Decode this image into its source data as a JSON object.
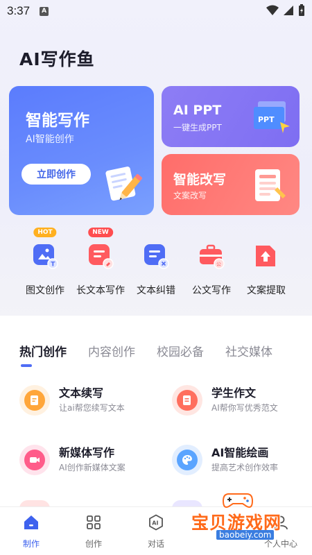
{
  "status_bar": {
    "time": "3:37",
    "badge": "A"
  },
  "app_title": "AI写作鱼",
  "cards": {
    "smart_write": {
      "title": "智能写作",
      "subtitle": "AI智能创作",
      "button": "立即创作"
    },
    "ppt": {
      "title": "AI PPT",
      "subtitle": "一键生成PPT",
      "art_label": "PPT"
    },
    "rewrite": {
      "title": "智能改写",
      "subtitle": "文案改写"
    }
  },
  "tools": [
    {
      "label": "图文创作",
      "tag": "HOT",
      "tag_color": "#ffb020"
    },
    {
      "label": "长文本写作",
      "tag": "NEW",
      "tag_color": "#ff4d4f"
    },
    {
      "label": "文本纠错",
      "tag": "",
      "tag_color": ""
    },
    {
      "label": "公文写作",
      "tag": "",
      "tag_color": ""
    },
    {
      "label": "文案提取",
      "tag": "",
      "tag_color": ""
    }
  ],
  "tabs": [
    "热门创作",
    "内容创作",
    "校园必备",
    "社交媒体"
  ],
  "active_tab": "热门创作",
  "features": [
    {
      "title": "文本续写",
      "desc": "让ai帮您续写文本",
      "color": "#ffa63a"
    },
    {
      "title": "学生作文",
      "desc": "AI帮你写优秀范文",
      "color": "#ff6f5e"
    },
    {
      "title": "新媒体写作",
      "desc": "AI创作新媒体文案",
      "color": "#ff5c8a"
    },
    {
      "title": "AI智能绘画",
      "desc": "提高艺术创作效率",
      "color": "#5aa4ff"
    }
  ],
  "bottom_nav": [
    {
      "label": "制作",
      "icon": "home-icon",
      "active": true
    },
    {
      "label": "创作",
      "icon": "grid-icon",
      "active": false
    },
    {
      "label": "对话",
      "icon": "ai-chat-icon",
      "active": false
    },
    {
      "label": "",
      "icon": "",
      "active": false
    },
    {
      "label": "个人中心",
      "icon": "user-icon",
      "active": false
    }
  ],
  "watermark": {
    "text": "宝贝游戏网",
    "url": "baobeiy.com"
  },
  "colors": {
    "primary": "#4f6df5",
    "ppt_card": "#8d7df5",
    "rewrite_card": "#ff7471"
  }
}
